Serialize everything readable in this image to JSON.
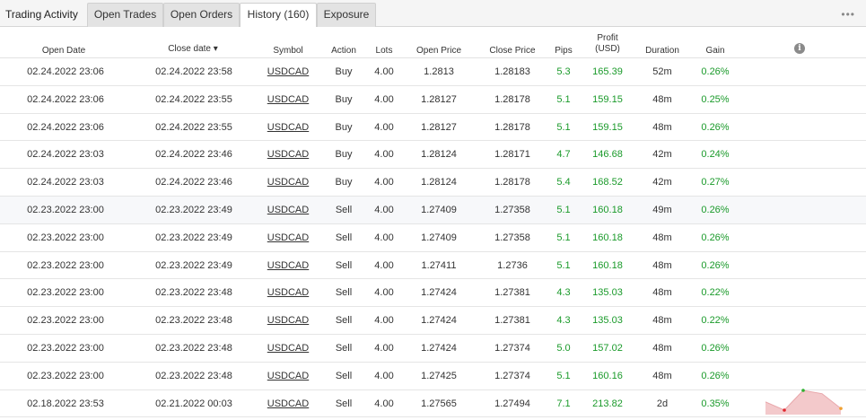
{
  "tabs": {
    "title": "Trading Activity",
    "items": [
      "Open Trades",
      "Open Orders",
      "History (160)",
      "Exposure"
    ],
    "active": "History (160)",
    "more": "•••"
  },
  "columns": {
    "open_date": "Open Date",
    "close_date": "Close date ▾",
    "symbol": "Symbol",
    "action": "Action",
    "lots": "Lots",
    "open_price": "Open Price",
    "close_price": "Close Price",
    "pips": "Pips",
    "profit": "Profit",
    "profit_unit": "(USD)",
    "duration": "Duration",
    "gain": "Gain",
    "info": "i"
  },
  "rows": [
    {
      "open_date": "02.24.2022 23:06",
      "close_date": "02.24.2022 23:58",
      "symbol": "USDCAD",
      "action": "Buy",
      "lots": "4.00",
      "open_price": "1.2813",
      "close_price": "1.28183",
      "pips": "5.3",
      "profit": "165.39",
      "duration": "52m",
      "gain": "0.26%"
    },
    {
      "open_date": "02.24.2022 23:06",
      "close_date": "02.24.2022 23:55",
      "symbol": "USDCAD",
      "action": "Buy",
      "lots": "4.00",
      "open_price": "1.28127",
      "close_price": "1.28178",
      "pips": "5.1",
      "profit": "159.15",
      "duration": "48m",
      "gain": "0.25%"
    },
    {
      "open_date": "02.24.2022 23:06",
      "close_date": "02.24.2022 23:55",
      "symbol": "USDCAD",
      "action": "Buy",
      "lots": "4.00",
      "open_price": "1.28127",
      "close_price": "1.28178",
      "pips": "5.1",
      "profit": "159.15",
      "duration": "48m",
      "gain": "0.26%"
    },
    {
      "open_date": "02.24.2022 23:03",
      "close_date": "02.24.2022 23:46",
      "symbol": "USDCAD",
      "action": "Buy",
      "lots": "4.00",
      "open_price": "1.28124",
      "close_price": "1.28171",
      "pips": "4.7",
      "profit": "146.68",
      "duration": "42m",
      "gain": "0.24%"
    },
    {
      "open_date": "02.24.2022 23:03",
      "close_date": "02.24.2022 23:46",
      "symbol": "USDCAD",
      "action": "Buy",
      "lots": "4.00",
      "open_price": "1.28124",
      "close_price": "1.28178",
      "pips": "5.4",
      "profit": "168.52",
      "duration": "42m",
      "gain": "0.27%"
    },
    {
      "open_date": "02.23.2022 23:00",
      "close_date": "02.23.2022 23:49",
      "symbol": "USDCAD",
      "action": "Sell",
      "lots": "4.00",
      "open_price": "1.27409",
      "close_price": "1.27358",
      "pips": "5.1",
      "profit": "160.18",
      "duration": "49m",
      "gain": "0.26%"
    },
    {
      "open_date": "02.23.2022 23:00",
      "close_date": "02.23.2022 23:49",
      "symbol": "USDCAD",
      "action": "Sell",
      "lots": "4.00",
      "open_price": "1.27409",
      "close_price": "1.27358",
      "pips": "5.1",
      "profit": "160.18",
      "duration": "48m",
      "gain": "0.26%"
    },
    {
      "open_date": "02.23.2022 23:00",
      "close_date": "02.23.2022 23:49",
      "symbol": "USDCAD",
      "action": "Sell",
      "lots": "4.00",
      "open_price": "1.27411",
      "close_price": "1.2736",
      "pips": "5.1",
      "profit": "160.18",
      "duration": "48m",
      "gain": "0.26%"
    },
    {
      "open_date": "02.23.2022 23:00",
      "close_date": "02.23.2022 23:48",
      "symbol": "USDCAD",
      "action": "Sell",
      "lots": "4.00",
      "open_price": "1.27424",
      "close_price": "1.27381",
      "pips": "4.3",
      "profit": "135.03",
      "duration": "48m",
      "gain": "0.22%"
    },
    {
      "open_date": "02.23.2022 23:00",
      "close_date": "02.23.2022 23:48",
      "symbol": "USDCAD",
      "action": "Sell",
      "lots": "4.00",
      "open_price": "1.27424",
      "close_price": "1.27381",
      "pips": "4.3",
      "profit": "135.03",
      "duration": "48m",
      "gain": "0.22%"
    },
    {
      "open_date": "02.23.2022 23:00",
      "close_date": "02.23.2022 23:48",
      "symbol": "USDCAD",
      "action": "Sell",
      "lots": "4.00",
      "open_price": "1.27424",
      "close_price": "1.27374",
      "pips": "5.0",
      "profit": "157.02",
      "duration": "48m",
      "gain": "0.26%"
    },
    {
      "open_date": "02.23.2022 23:00",
      "close_date": "02.23.2022 23:48",
      "symbol": "USDCAD",
      "action": "Sell",
      "lots": "4.00",
      "open_price": "1.27425",
      "close_price": "1.27374",
      "pips": "5.1",
      "profit": "160.16",
      "duration": "48m",
      "gain": "0.26%"
    },
    {
      "open_date": "02.18.2022 23:53",
      "close_date": "02.21.2022 00:03",
      "symbol": "USDCAD",
      "action": "Sell",
      "lots": "4.00",
      "open_price": "1.27565",
      "close_price": "1.27494",
      "pips": "7.1",
      "profit": "213.82",
      "duration": "2d",
      "gain": "0.35%"
    }
  ],
  "row_shading": [
    "white",
    "white",
    "white",
    "white",
    "white",
    "shaded",
    "white",
    "white",
    "white",
    "white",
    "white",
    "white",
    "white"
  ],
  "colors": {
    "positive": "#1a9a2a",
    "sparkline_fill": "#f3c9cb",
    "sparkline_line": "#e8a6aa",
    "sparkline_low": "#e0262e",
    "sparkline_high": "#2fb12f",
    "sparkline_end": "#f0a030"
  },
  "sparkline": {
    "values": [
      0.3,
      -0.2,
      1.0,
      0.8,
      -0.1
    ]
  }
}
